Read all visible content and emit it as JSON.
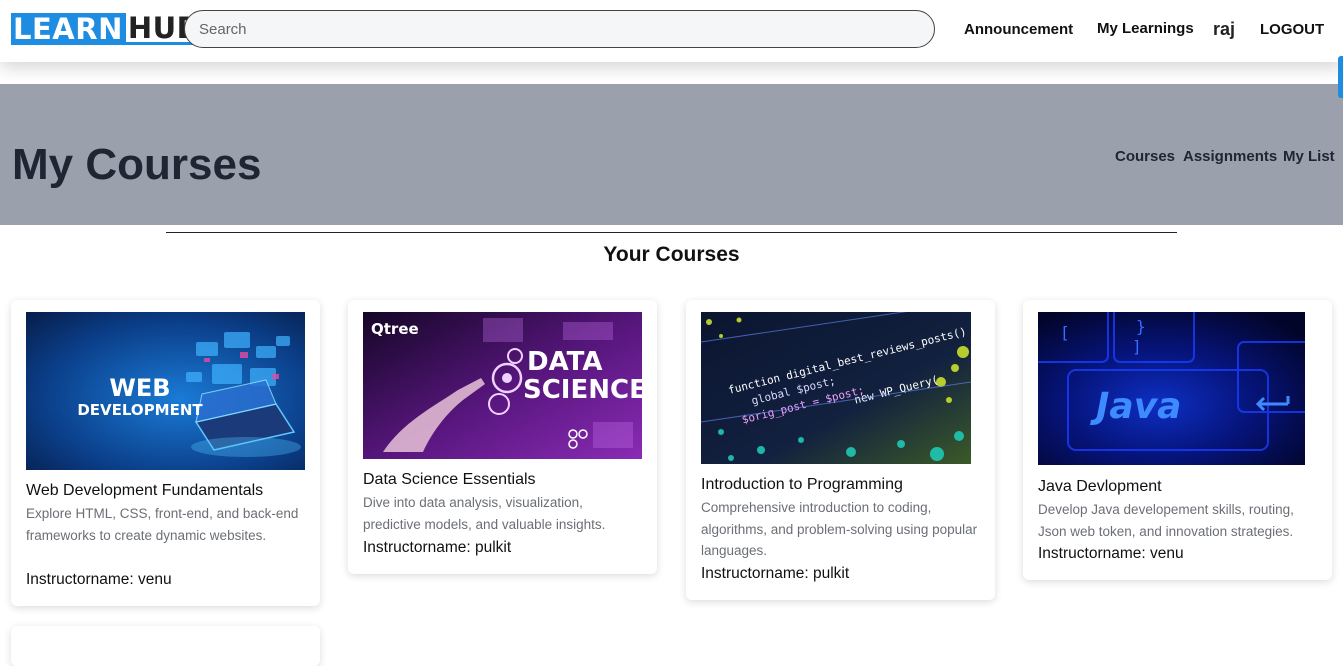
{
  "navbar": {
    "logo_left": "LEARN",
    "logo_right": "HUB",
    "search_placeholder": "Search",
    "links": [
      "Announcement",
      "My Learnings"
    ],
    "user": "raj",
    "logout": "LOGOUT"
  },
  "banner": {
    "title": "My Courses",
    "links": [
      "Courses",
      "Assignments",
      "My List"
    ]
  },
  "section": {
    "title": "Your Courses"
  },
  "courses": [
    {
      "image_label": [
        "WEB",
        "DEVELOPMENT"
      ],
      "title": "Web Development Fundamentals",
      "description": "Explore HTML, CSS, front-end, and back-end frameworks to create dynamic websites.",
      "instructor": "Instructorname: venu"
    },
    {
      "image_label": [
        "DATA",
        "SCIENCE"
      ],
      "image_brand": "Qtree",
      "title": "Data Science Essentials",
      "description": "Dive into data analysis, visualization, predictive models, and valuable insights.",
      "instructor": "Instructorname: pulkit"
    },
    {
      "image_label": [
        "function digital_best_reviews_posts()",
        "global $post;",
        "$orig_post = $post;",
        "new WP_Query("
      ],
      "title": "Introduction to Programming",
      "description": "Comprehensive introduction to coding, algorithms, and problem-solving using popular languages.",
      "instructor": "Instructorname: pulkit"
    },
    {
      "image_label": [
        "Java"
      ],
      "title": "Java Devlopment",
      "description": "Develop Java developement skills, routing, Json web token, and innovation strategies.",
      "instructor": "Instructorname: venu"
    }
  ]
}
